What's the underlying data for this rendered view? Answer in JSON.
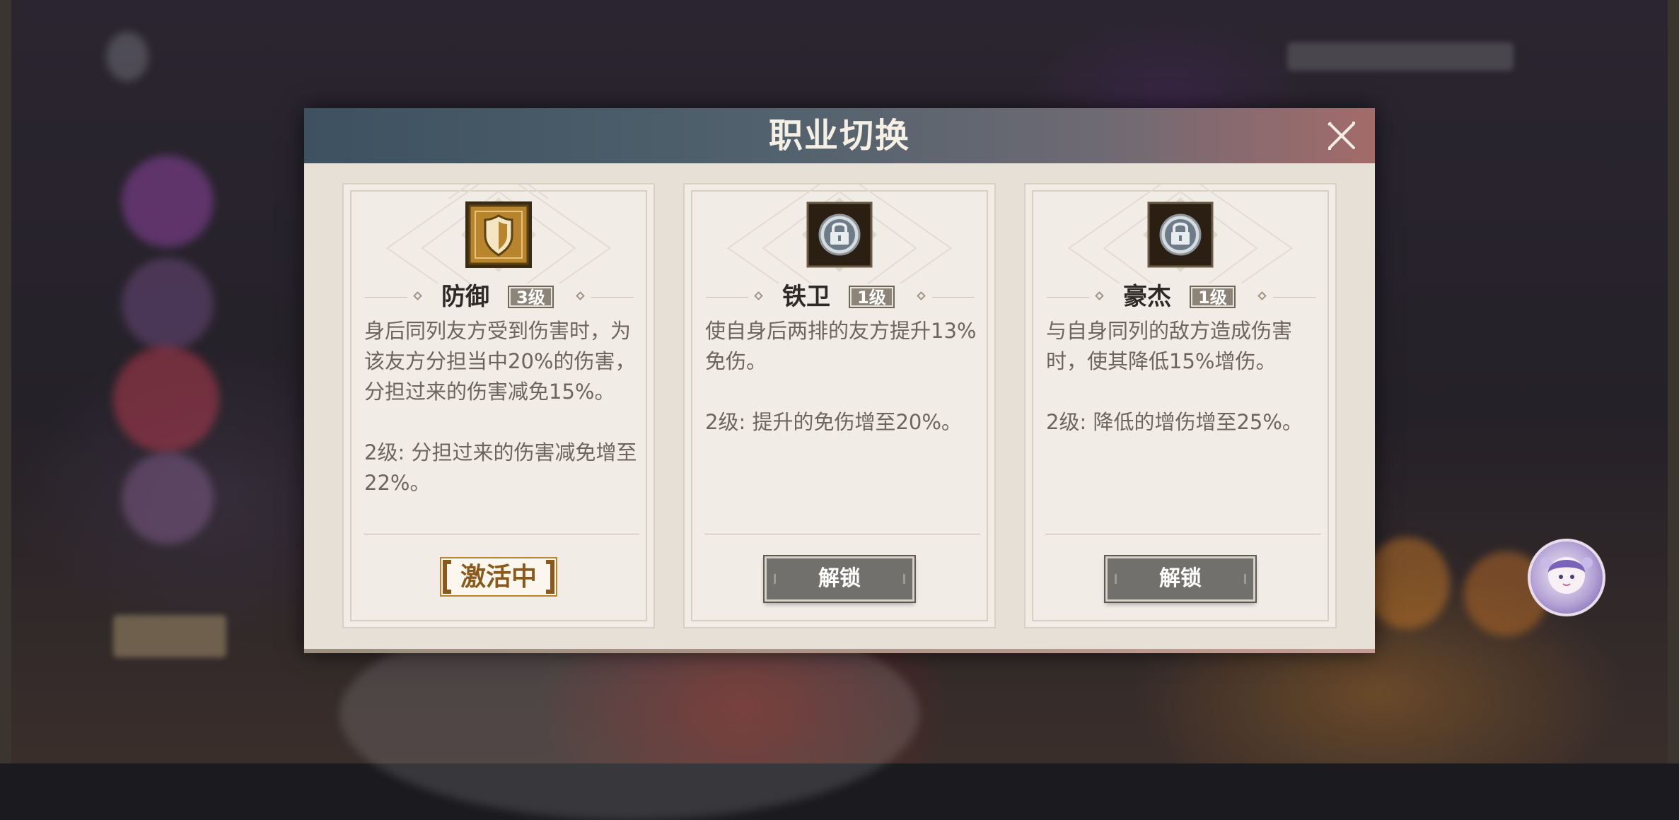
{
  "dialog": {
    "title": "职业切换",
    "close_icon": "close-icon"
  },
  "cards": [
    {
      "name": "防御",
      "level": "3级",
      "icon": "shield-icon",
      "state": "active",
      "description": [
        "身后同列友方受到伤害时，为该友方分担当中20%的伤害，分担过来的伤害减免15%。"
      ],
      "upgrade": "2级: 分担过来的伤害减免增至22%。",
      "status_label": "激活中"
    },
    {
      "name": "铁卫",
      "level": "1级",
      "icon": "lock-icon",
      "state": "locked",
      "description": [
        "使自身后两排的友方提升13%免伤。"
      ],
      "upgrade": "2级: 提升的免伤增至20%。",
      "button_label": "解锁"
    },
    {
      "name": "豪杰",
      "level": "1级",
      "icon": "lock-icon",
      "state": "locked",
      "description": [
        "与自身同列的敌方造成伤害时，使其降低15%增伤。"
      ],
      "upgrade": "2级: 降低的增伤增至25%。",
      "button_label": "解锁"
    }
  ],
  "colors": {
    "header_left": "#3d5160",
    "header_right": "#a36b6a",
    "card_bg": "#f1ede6",
    "active_gold": "#b9852e",
    "locked_button": "#72706c"
  }
}
